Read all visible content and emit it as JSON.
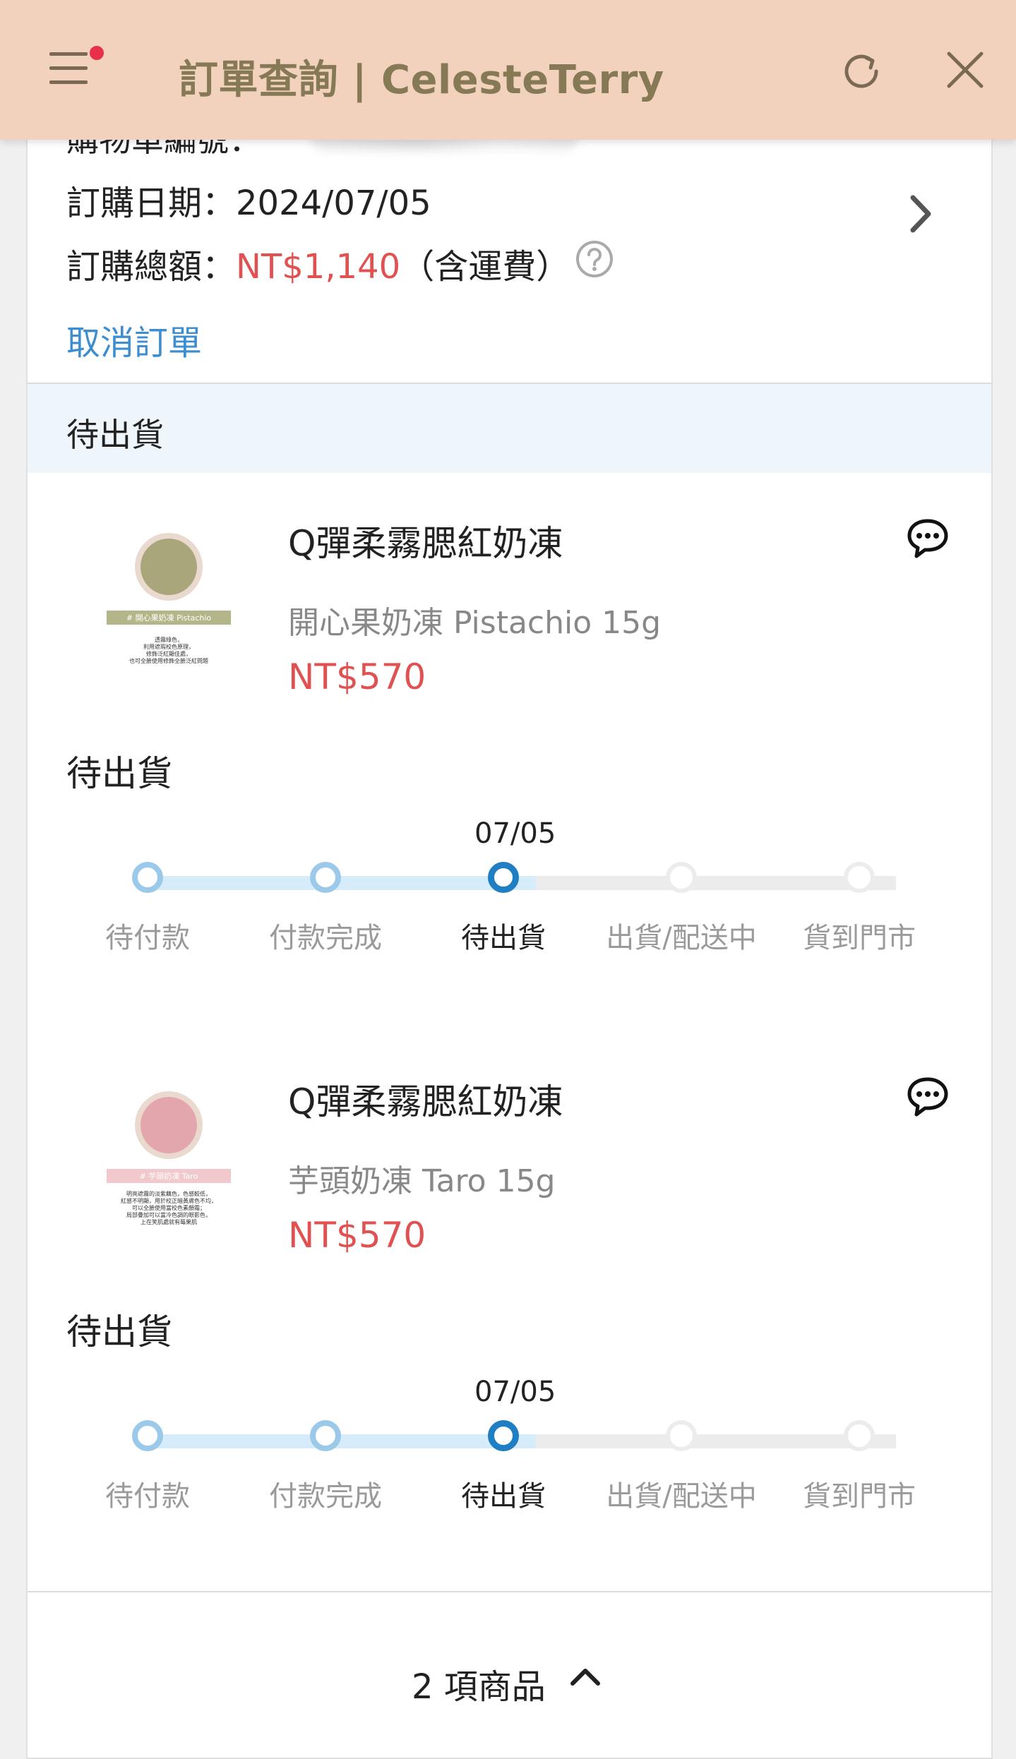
{
  "header": {
    "title": "訂單查詢 | CelesteTerry"
  },
  "order": {
    "number_label": "購物單編號：",
    "date_label": "訂購日期：",
    "date_value": "2024/07/05",
    "total_label": "訂購總額：",
    "total_value": "NT$1,140",
    "total_note": "（含運費）",
    "cancel_label": "取消訂單",
    "status": "待出貨"
  },
  "colors": {
    "header_bg": "#f2d2bd",
    "price_red": "#e05252",
    "link_blue": "#3d8ed0",
    "step_done": "#9bc9ea",
    "step_current": "#1f7fc2"
  },
  "products": [
    {
      "name": "Q彈柔霧腮紅奶凍",
      "variant": "開心果奶凍 Pistachio 15g",
      "price": "NT$570",
      "status": "待出貨",
      "timeline_date": "07/05",
      "thumb_tag": "# 開心果奶凍 Pistachio",
      "thumb_lines": [
        "透霧綠色，",
        "利用遮瑕校色原理，",
        "修飾泛紅顯佳處，",
        "也可全臉使用修飾全臉泛紅問題"
      ]
    },
    {
      "name": "Q彈柔霧腮紅奶凍",
      "variant": "芋頭奶凍 Taro 15g",
      "price": "NT$570",
      "status": "待出貨",
      "timeline_date": "07/05",
      "thumb_tag": "# 芋頭奶凍 Taro",
      "thumb_lines": [
        "明亮遮霧的淡紫藕色，色感較低，",
        "紅感不明顯，用於校正暗黃膚色不均，",
        "可以全臉使用當校色素顏霜；",
        "局部疊加可以當冷色調的眼影色，",
        "上在笑肌處就有莓果肌"
      ]
    }
  ],
  "timeline_steps": [
    "待付款",
    "付款完成",
    "待出貨",
    "出貨/配送中",
    "貨到門市"
  ],
  "timeline_current_index": 2,
  "footer": {
    "count": "2 項商品"
  }
}
